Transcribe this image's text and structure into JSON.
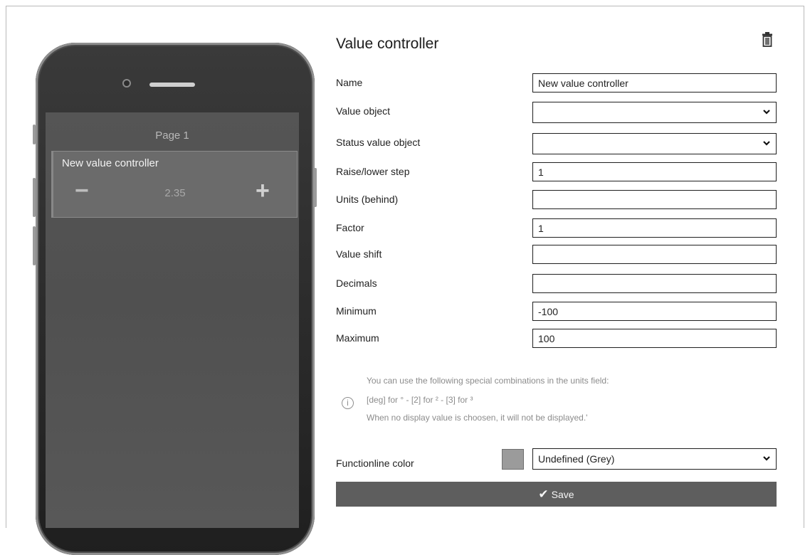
{
  "preview": {
    "page_title": "Page 1",
    "tile": {
      "name": "New value controller",
      "minus": "−",
      "value": "2.35",
      "plus": "+"
    }
  },
  "form": {
    "title": "Value controller",
    "fields": [
      {
        "label": "Name",
        "value": "New value controller",
        "type": "text"
      },
      {
        "label": "Value object",
        "value": "",
        "type": "select"
      },
      {
        "label": "Status value object",
        "value": "",
        "type": "select"
      },
      {
        "label": "Raise/lower step",
        "value": "1",
        "type": "text"
      },
      {
        "label": "Units (behind)",
        "value": "",
        "type": "text"
      },
      {
        "label": "Factor",
        "value": "1",
        "type": "text"
      },
      {
        "label": "Value shift",
        "value": "",
        "type": "text"
      },
      {
        "label": "Decimals",
        "value": "",
        "type": "text"
      },
      {
        "label": "Minimum",
        "value": "-100",
        "type": "text"
      },
      {
        "label": "Maximum",
        "value": "100",
        "type": "text"
      }
    ],
    "info": {
      "icon": "i",
      "lines": [
        "You can use the following special combinations in the units field:",
        "[deg] for ° - [2] for ² - [3] for ³",
        "When no display value is choosen, it will not be displayed.'"
      ]
    },
    "functionline": {
      "label": "Functionline color",
      "value": "Undefined (Grey)",
      "swatch_color": "#9b9b9b"
    },
    "save_label": "Save"
  },
  "icons": {
    "trash": "trash-icon",
    "chevron": "chevron-down-icon",
    "info": "info-icon",
    "check": "check-icon"
  }
}
